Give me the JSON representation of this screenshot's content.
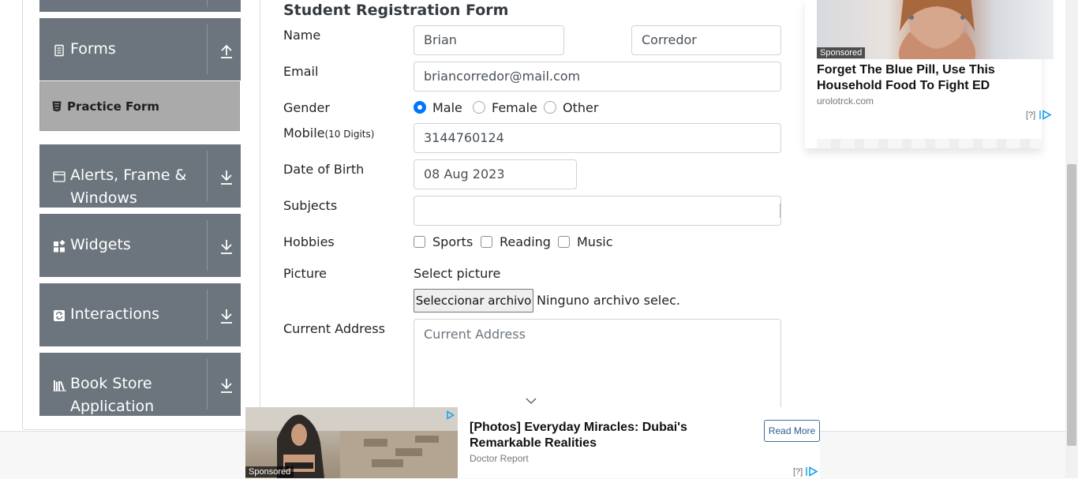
{
  "sidebar": {
    "groups": [
      {
        "label": "Forms",
        "icon": "form-icon",
        "arrow": "up"
      },
      {
        "label": "Alerts, Frame & Windows",
        "icon": "window-icon",
        "arrow": "down"
      },
      {
        "label": "Widgets",
        "icon": "widgets-icon",
        "arrow": "down"
      },
      {
        "label": "Interactions",
        "icon": "interactions-icon",
        "arrow": "down"
      },
      {
        "label": "Book Store Application",
        "icon": "books-icon",
        "arrow": "down"
      }
    ],
    "sub_item": {
      "label": "Practice Form",
      "icon": "html5-icon"
    }
  },
  "form": {
    "title": "Student Registration Form",
    "name_label": "Name",
    "first_name": "Brian",
    "last_name": "Corredor",
    "email_label": "Email",
    "email": "briancorredor@mail.com",
    "gender_label": "Gender",
    "gender_options": [
      "Male",
      "Female",
      "Other"
    ],
    "gender_selected": "Male",
    "mobile_label": "Mobile",
    "mobile_hint": "(10 Digits)",
    "mobile": "3144760124",
    "dob_label": "Date of Birth",
    "dob": "08 Aug 2023",
    "subjects_label": "Subjects",
    "subjects": "",
    "hobbies_label": "Hobbies",
    "hobbies": [
      "Sports",
      "Reading",
      "Music"
    ],
    "picture_label": "Picture",
    "select_picture": "Select picture",
    "file_button": "Seleccionar archivo",
    "file_status": "Ninguno archivo selec.",
    "address_label": "Current Address",
    "address_placeholder": "Current Address"
  },
  "ad_right": {
    "sponsored": "Sponsored",
    "title": "Forget The Blue Pill, Use This Household Food To Fight ED",
    "source": "urolotrck.com",
    "help": "[?]"
  },
  "ad_bottom": {
    "sponsored": "Sponsored",
    "title": "[Photos] Everyday Miracles: Dubai's Remarkable Realities",
    "source": "Doctor Report",
    "button": "Read More",
    "help": "[?]"
  },
  "colors": {
    "sidebar_group": "#6c757d",
    "sidebar_active": "#aaaaaa",
    "radio_accent": "#0075ff",
    "adchoices": "#1aa3e8"
  }
}
